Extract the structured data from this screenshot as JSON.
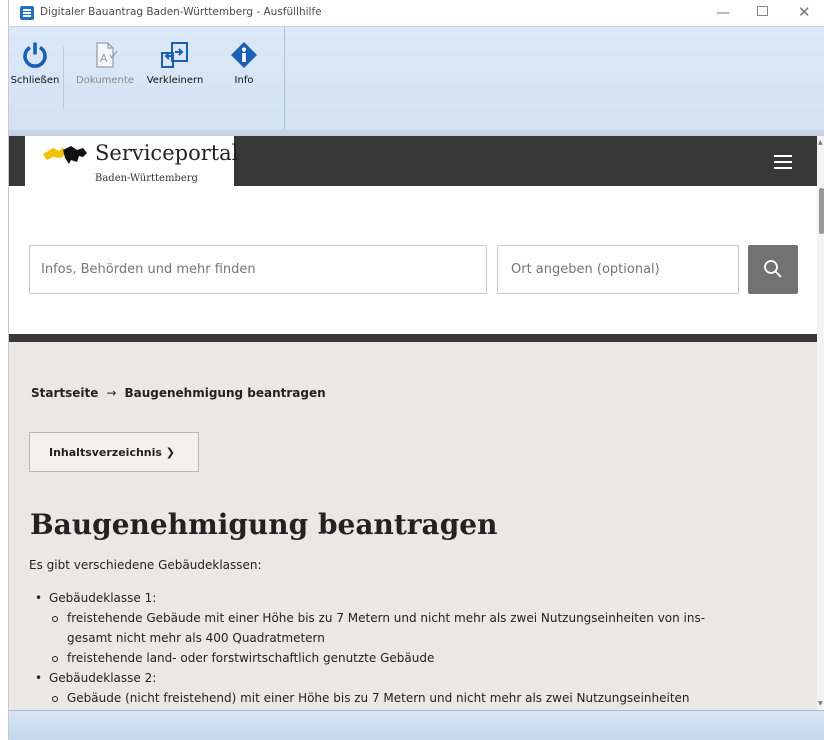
{
  "window": {
    "title": "Digitaler Bauantrag Baden-Württemberg - Ausfüllhilfe",
    "controls": {
      "minimize": "—",
      "close": "✕"
    }
  },
  "toolbar": {
    "buttons": [
      {
        "label": "Schließen",
        "icon": "power-icon",
        "enabled": true
      },
      {
        "label": "Dokumente",
        "icon": "document-check-icon",
        "enabled": false
      },
      {
        "label": "Verkleinern",
        "icon": "shrink-window-icon",
        "enabled": true
      },
      {
        "label": "Info",
        "icon": "info-icon",
        "enabled": true
      }
    ]
  },
  "site": {
    "logo_title": "Serviceportal",
    "logo_subtitle": "Baden-Württemberg",
    "search_placeholder": "Infos, Behörden und mehr finden",
    "place_placeholder": "Ort angeben (optional)"
  },
  "breadcrumb": {
    "home": "Startseite",
    "separator": "→",
    "current": "Baugenehmigung beantragen"
  },
  "toc_label": "Inhaltsverzeichnis ❯",
  "page": {
    "title": "Baugenehmigung beantragen",
    "intro": "Es gibt verschiedene Gebäudeklassen:",
    "list": {
      "class1": "Gebäudeklasse 1:",
      "class1_item1_line1": "freistehende Gebäude mit einer Höhe bis zu 7 Metern und nicht mehr als zwei Nutzungseinheiten von ins-",
      "class1_item1_line2": "gesamt nicht mehr als 400 Quadratmetern",
      "class1_item2": "freistehende land- oder forstwirtschaftlich genutzte Gebäude",
      "class2": "Gebäudeklasse 2:",
      "class2_item1": "Gebäude (nicht freistehend) mit einer Höhe bis zu 7 Metern und nicht mehr als zwei Nutzungseinheiten"
    }
  },
  "colors": {
    "header_dark": "#383838",
    "content_bg": "#ebe8e3",
    "ribbon_bg": "#d6e4f5",
    "accent_blue": "#1a5fb4",
    "logo_yellow": "#f2c200"
  }
}
